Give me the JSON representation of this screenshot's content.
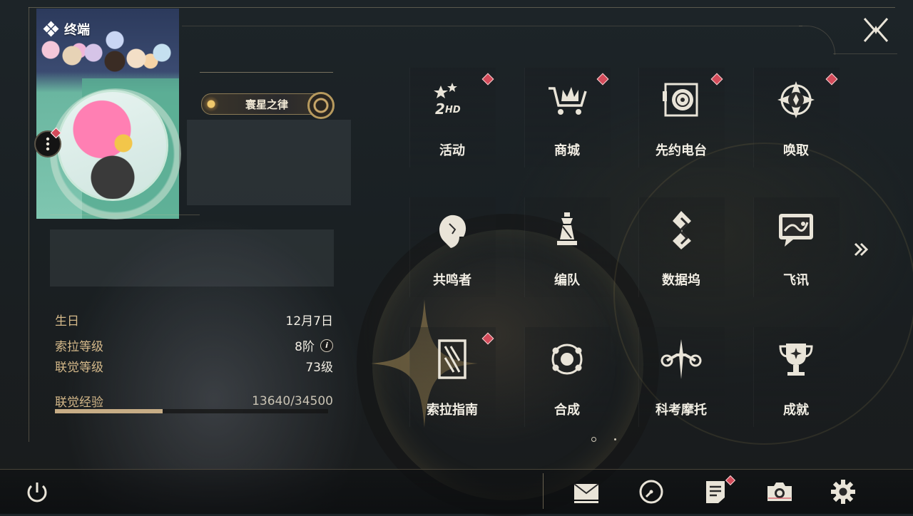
{
  "card": {
    "title": "终端",
    "badge_title": "寰星之律"
  },
  "stats": {
    "birthday_label": "生日",
    "birthday_value": "12月7日",
    "sola_level_label": "索拉等级",
    "sola_level_value": "8阶",
    "union_level_label": "联觉等级",
    "union_level_value": "73级",
    "union_exp_label": "联觉经验",
    "union_exp_value": "13640/34500",
    "union_exp_progress": 0.395
  },
  "menu": [
    {
      "label": "活动",
      "icon": "activity-2hd-icon",
      "alert": true
    },
    {
      "label": "商城",
      "icon": "shop-cart-icon",
      "alert": true
    },
    {
      "label": "先约电台",
      "icon": "radio-record-icon",
      "alert": true
    },
    {
      "label": "唤取",
      "icon": "convene-compass-icon",
      "alert": true
    },
    {
      "label": "共鸣者",
      "icon": "resonator-portrait-icon",
      "alert": false
    },
    {
      "label": "编队",
      "icon": "team-chess-icon",
      "alert": false
    },
    {
      "label": "数据坞",
      "icon": "data-dock-icon",
      "alert": false
    },
    {
      "label": "飞讯",
      "icon": "chat-bubble-icon",
      "alert": false
    },
    {
      "label": "索拉指南",
      "icon": "guide-card-icon",
      "alert": true
    },
    {
      "label": "合成",
      "icon": "synthesis-orbit-icon",
      "alert": false
    },
    {
      "label": "科考摩托",
      "icon": "motorbike-icon",
      "alert": false
    },
    {
      "label": "成就",
      "icon": "trophy-icon",
      "alert": false
    }
  ],
  "pagination": {
    "pages": 2,
    "current": 1
  },
  "icons": {
    "close": "close-icon",
    "next": "chevron-double-right-icon",
    "power": "power-icon",
    "mail": "mail-icon",
    "clock": "clock-icon",
    "notes": "notes-icon",
    "camera": "camera-icon",
    "settings": "gear-icon",
    "more": "more-vertical-icon"
  },
  "colors": {
    "accent_gold": "#d5b98a",
    "alert_red": "#d44b5a",
    "text_light": "#f2eee4"
  }
}
